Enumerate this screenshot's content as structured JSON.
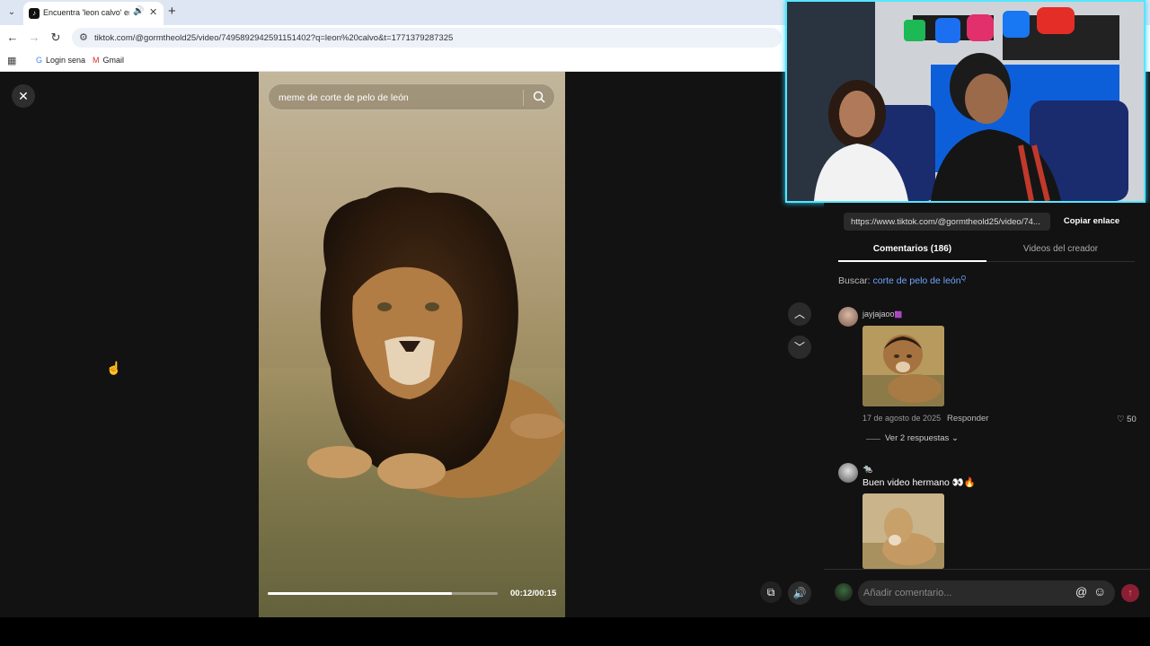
{
  "browser": {
    "tab_title": "Encuentra 'leon calvo' en TikTok",
    "tab_audio_icon": "speaker-icon",
    "url": "tiktok.com/@gormtheold25/video/7495892942591151402?q=leon%20calvo&t=1771379287325",
    "bookmarks": [
      {
        "label": "Login sena",
        "icon": "google-icon"
      },
      {
        "label": "Gmail",
        "icon": "gmail-icon"
      }
    ]
  },
  "video": {
    "search_text": "meme de corte de pelo de león",
    "time": "00:12/00:15",
    "progress": 0.8
  },
  "panel": {
    "link": "https://www.tiktok.com/@gormtheold25/video/74...",
    "copy_label": "Copiar enlace",
    "tab_comments": "Comentarios (186)",
    "tab_videos": "Videos del creador",
    "search_label": "Buscar:",
    "search_term": "corte de pelo de león",
    "search_sup": "Q"
  },
  "comments": [
    {
      "user": "jayjajaoo",
      "badge": "🟪",
      "date": "17 de agosto de 2025",
      "reply_label": "Responder",
      "likes": "50",
      "replies_label": "Ver 2 respuestas"
    },
    {
      "user": "🐀",
      "text": "Buen video hermano 👀🔥"
    }
  ],
  "comment_input": {
    "placeholder": "Añadir comentario..."
  },
  "colors": {
    "accent_link": "#6fa5ff",
    "webcam_border": "#55e6ff",
    "send_button": "#8a1f33"
  }
}
